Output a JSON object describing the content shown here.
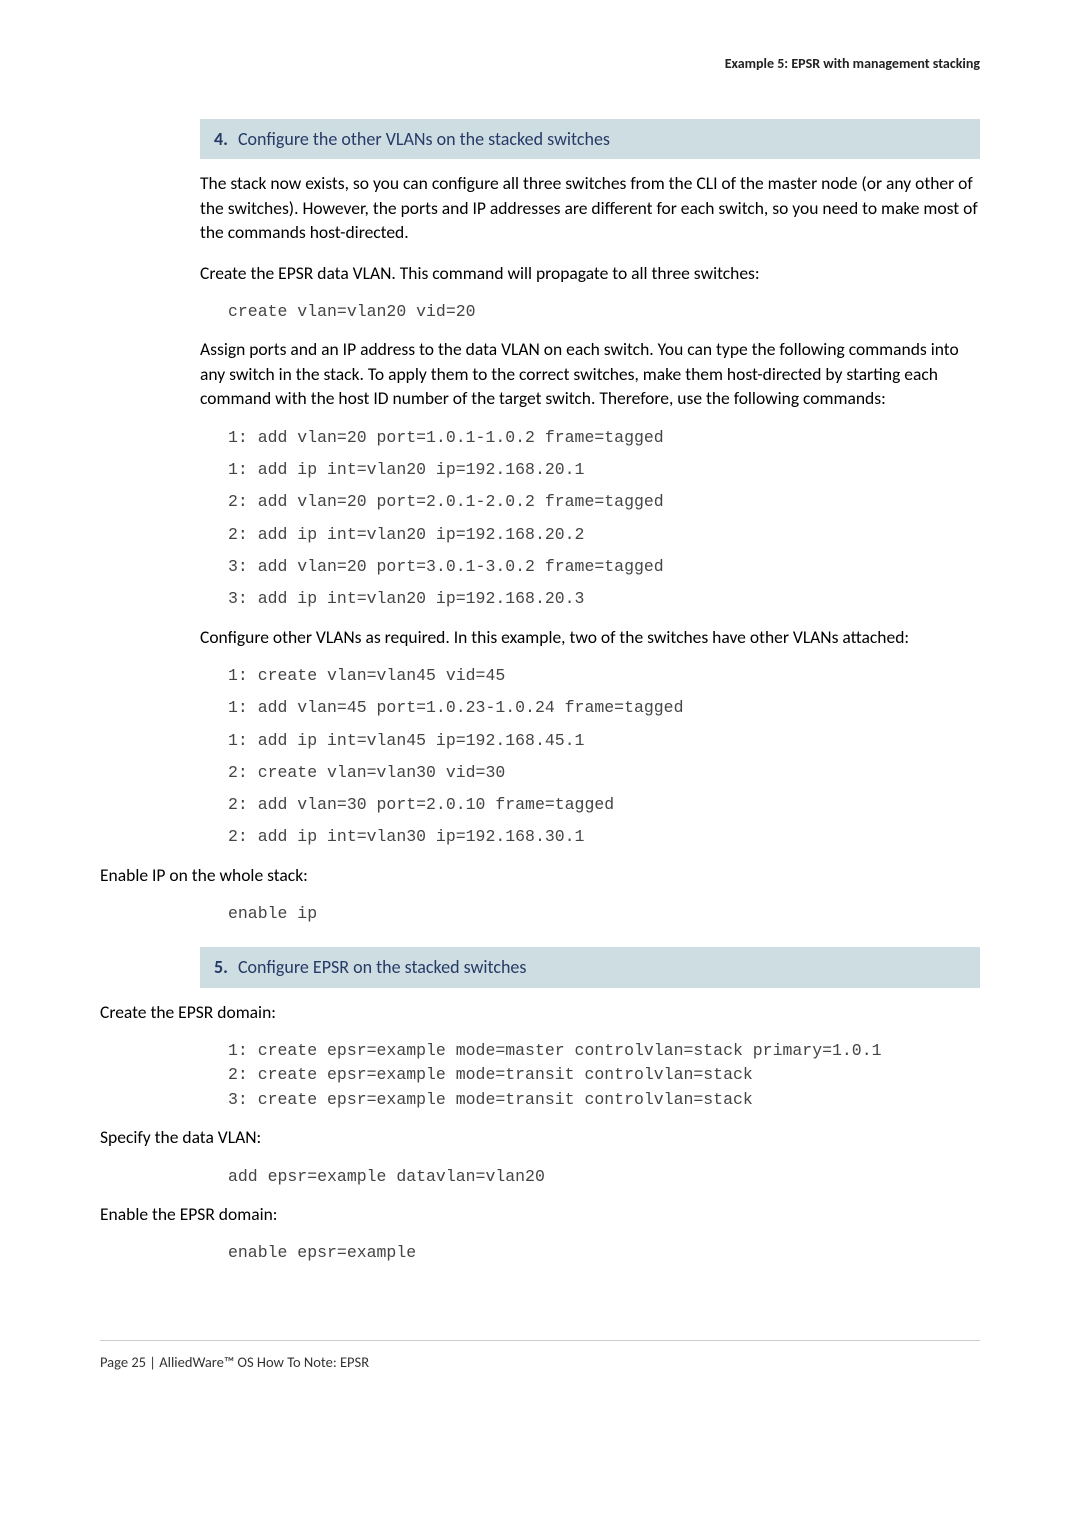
{
  "header": {
    "running_title": "Example 5: EPSR with management stacking"
  },
  "step4": {
    "num": "4.",
    "title": "Configure the other VLANs on the stacked switches",
    "p1": "The stack now exists, so you can configure all three switches from the CLI of the master node (or any other of the switches). However, the ports and IP addresses are different for each switch, so you need to make most of the commands host-directed.",
    "p2": "Create the EPSR data VLAN. This command will propagate to all three switches:",
    "code1": [
      "create vlan=vlan20 vid=20"
    ],
    "p3": "Assign ports and an IP address to the data VLAN on each switch. You can type the following commands into any switch in the stack. To apply them to the correct switches, make them host-directed by starting each command with the host ID number of the target switch. Therefore, use the following commands:",
    "code2": [
      "1: add vlan=20 port=1.0.1-1.0.2 frame=tagged",
      "1: add ip int=vlan20 ip=192.168.20.1",
      "2: add vlan=20 port=2.0.1-2.0.2 frame=tagged",
      "2: add ip int=vlan20 ip=192.168.20.2",
      "3: add vlan=20 port=3.0.1-3.0.2 frame=tagged",
      "3: add ip int=vlan20 ip=192.168.20.3"
    ],
    "p4": "Configure other VLANs as required. In this example, two of the switches have other VLANs attached:",
    "code3": [
      "1: create vlan=vlan45 vid=45",
      "1: add vlan=45 port=1.0.23-1.0.24 frame=tagged",
      "1: add ip int=vlan45 ip=192.168.45.1",
      "2: create vlan=vlan30 vid=30",
      "2: add vlan=30 port=2.0.10 frame=tagged",
      "2: add ip int=vlan30 ip=192.168.30.1"
    ],
    "p5": "Enable IP on the whole stack:",
    "code4": [
      "enable ip"
    ]
  },
  "step5": {
    "num": "5.",
    "title": "Configure EPSR on the stacked switches",
    "p1": "Create the EPSR domain:",
    "code1": [
      "1: create epsr=example mode=master controlvlan=stack primary=1.0.1",
      "2: create epsr=example mode=transit controlvlan=stack",
      "3: create epsr=example mode=transit controlvlan=stack"
    ],
    "p2": "Specify the data VLAN:",
    "code2": [
      "add epsr=example datavlan=vlan20"
    ],
    "p3": "Enable the EPSR domain:",
    "code3": [
      "enable epsr=example"
    ]
  },
  "footer": {
    "text": "Page 25 | AlliedWare™ OS How To Note: EPSR"
  }
}
